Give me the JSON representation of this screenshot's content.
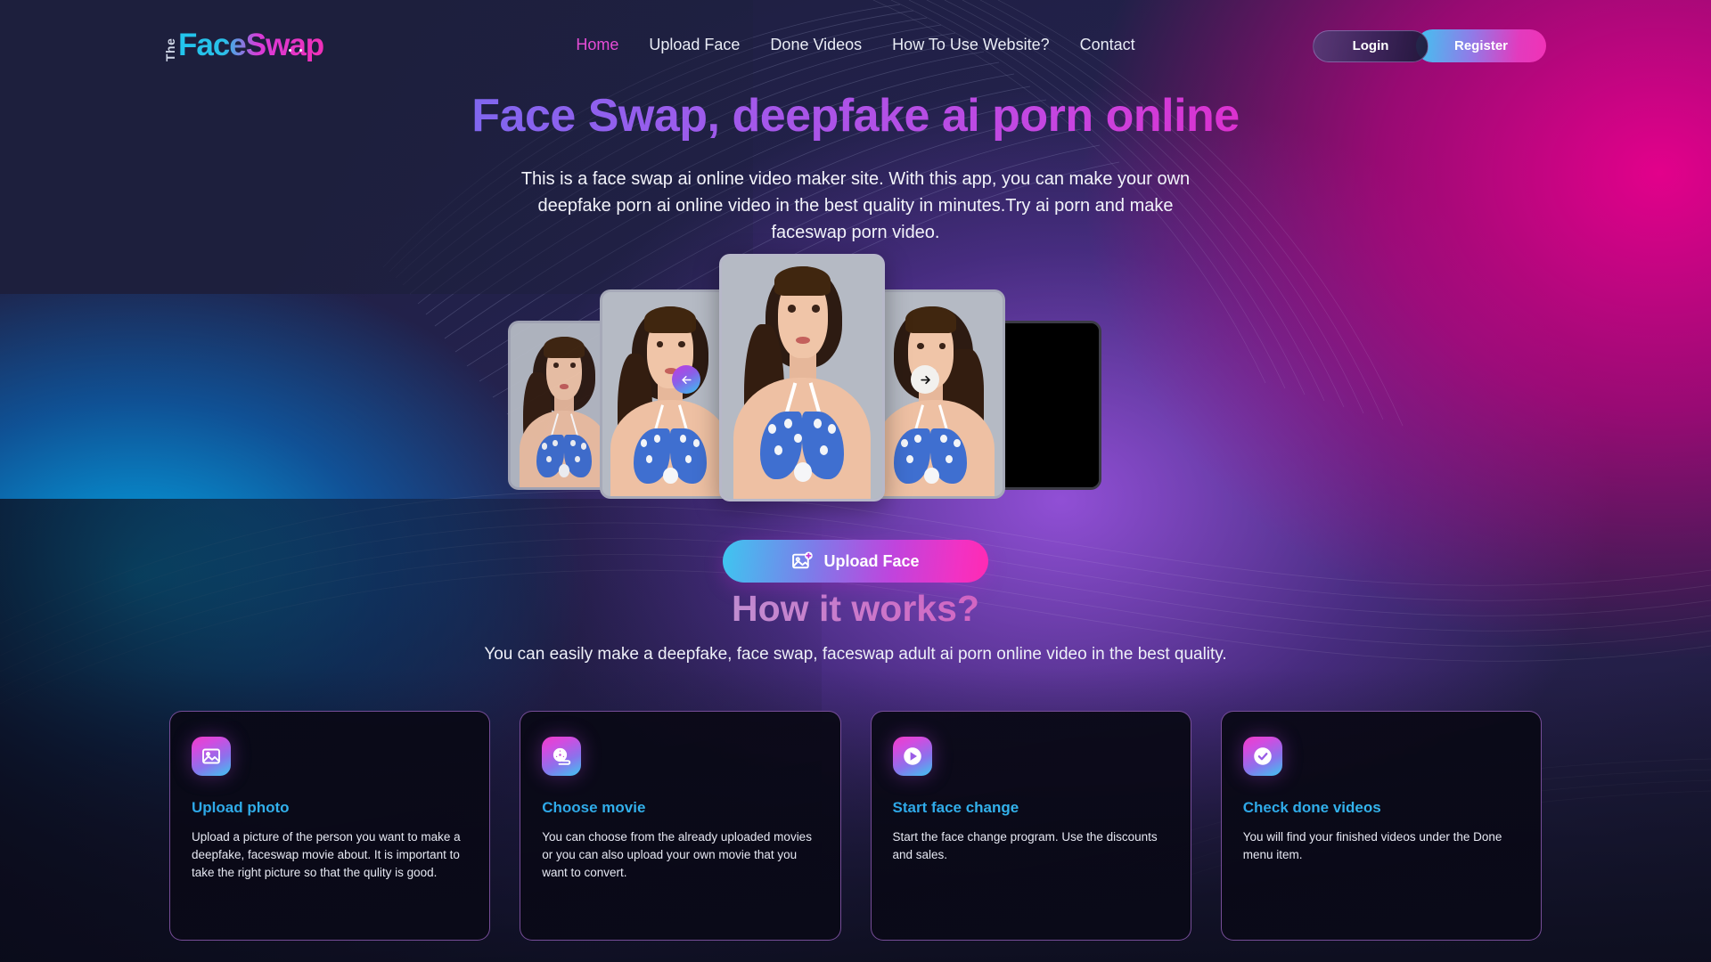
{
  "brand": {
    "prefix": "The",
    "name": "FaceSwap"
  },
  "nav": {
    "links": [
      {
        "label": "Home",
        "active": true
      },
      {
        "label": "Upload Face",
        "active": false
      },
      {
        "label": "Done Videos",
        "active": false
      },
      {
        "label": "How To Use Website?",
        "active": false
      },
      {
        "label": "Contact",
        "active": false
      }
    ],
    "login_label": "Login",
    "register_label": "Register"
  },
  "hero": {
    "title": "Face Swap, deepfake ai porn online",
    "subtitle": "This is a face swap ai online video maker site. With this app, you can make your own deepfake porn ai online video in the best quality in minutes.Try ai porn and make faceswap porn video.",
    "upload_label": "Upload Face",
    "upload_icon": "image-add-icon",
    "carousel": {
      "prev_icon": "arrow-left-icon",
      "next_icon": "arrow-right-icon",
      "slides": [
        {
          "name": "slide-1"
        },
        {
          "name": "slide-2"
        },
        {
          "name": "slide-3"
        },
        {
          "name": "slide-4"
        },
        {
          "name": "slide-5"
        }
      ]
    }
  },
  "how_it_works": {
    "title": "How it works?",
    "subtitle": "You can easily make a deepfake, face swap, faceswap adult ai porn online video in the best quality.",
    "cards": [
      {
        "icon": "image-icon",
        "title": "Upload photo",
        "body": "Upload a picture of the person you want to make a deepfake, faceswap movie about. It is important to take the right picture so that the qulity is good."
      },
      {
        "icon": "film-reel-icon",
        "title": "Choose movie",
        "body": "You can choose from the already uploaded movies or you can also upload your own movie that you want to convert."
      },
      {
        "icon": "play-circle-icon",
        "title": "Start face change",
        "body": "Start the face change program. Use the discounts and sales."
      },
      {
        "icon": "check-circle-icon",
        "title": "Check done videos",
        "body": "You will find your finished videos under the Done menu item."
      }
    ]
  },
  "colors": {
    "accent_pink": "#e64cd6",
    "accent_cyan": "#3ec6f0",
    "accent_magenta": "#ff2ab2",
    "background_navy": "#1c1e3c",
    "card_background": "#0a0916",
    "card_border": "#ba78e6"
  }
}
